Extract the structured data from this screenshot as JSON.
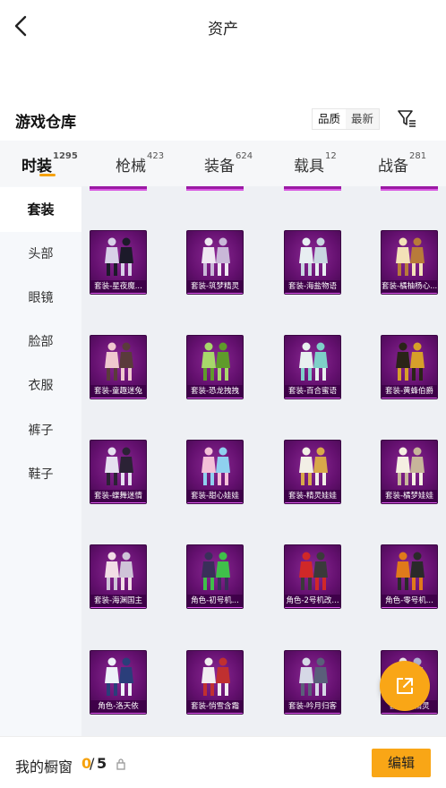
{
  "header": {
    "title": "资产"
  },
  "warehouse": {
    "title": "游戏仓库",
    "sort_options": [
      "品质",
      "最新"
    ],
    "filter_icon": "filter-icon"
  },
  "tabs": [
    {
      "label": "时装",
      "count": "1295",
      "active": true
    },
    {
      "label": "枪械",
      "count": "423"
    },
    {
      "label": "装备",
      "count": "624"
    },
    {
      "label": "载具",
      "count": "12"
    },
    {
      "label": "战备",
      "count": "281"
    }
  ],
  "sidebar": [
    {
      "label": "套装",
      "active": true
    },
    {
      "label": "头部"
    },
    {
      "label": "眼镜"
    },
    {
      "label": "脸部"
    },
    {
      "label": "衣服"
    },
    {
      "label": "裤子"
    },
    {
      "label": "鞋子"
    }
  ],
  "items": [
    "套装-星夜魔...",
    "套装-筑梦精灵",
    "套装-海盐物语",
    "套装-橘柚杨心...",
    "套装-童趣迷兔",
    "套装-恐龙拽拽",
    "套装-百合蜜语",
    "套装-黄蜂伯爵",
    "套装-蝶舞迷情",
    "套装-甜心娃娃",
    "套装-精灵娃娃",
    "套装-橘梦娃娃",
    "套装-海渊国主",
    "角色-初号机...",
    "角色-2号机改...",
    "角色-零号机...",
    "角色-洛天依",
    "套装-悄雪含霜",
    "套装-吟月归客",
    "套装-...精灵"
  ],
  "bottom": {
    "wardrobe_label": "我的橱窗",
    "count_current": "0",
    "count_separator": "/",
    "count_max": "5",
    "edit_label": "编辑"
  },
  "colors": {
    "accent": "#f9a616",
    "tile_purple": "#64106f",
    "tile_highlight": "#e05cf0"
  }
}
